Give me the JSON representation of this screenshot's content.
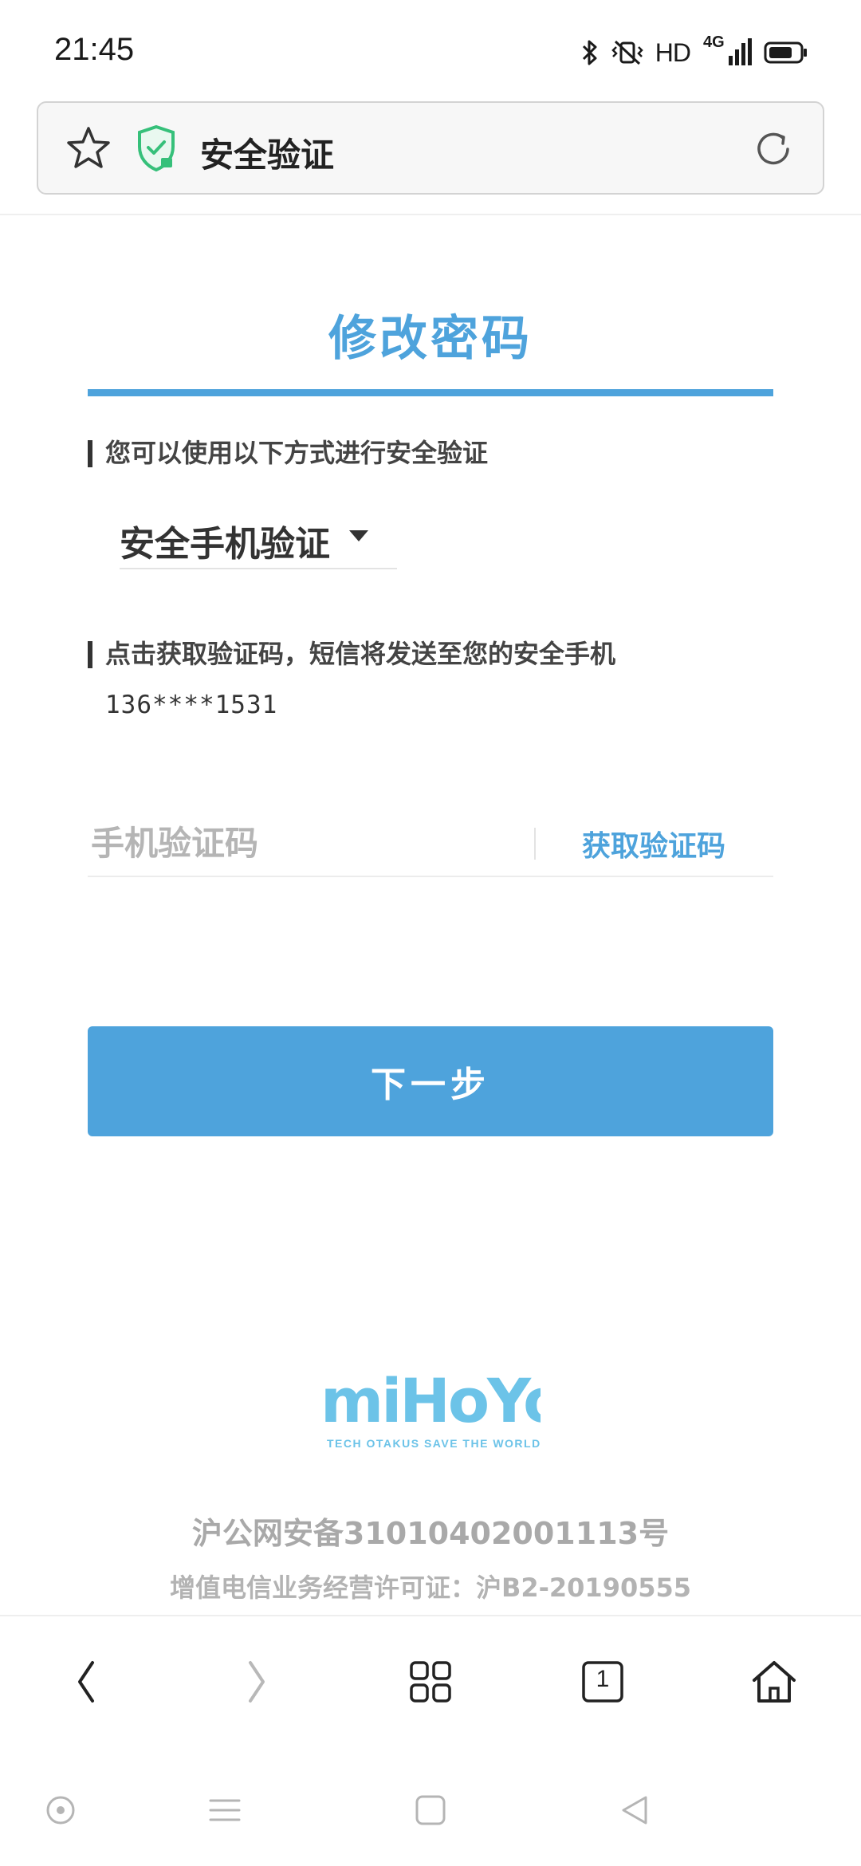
{
  "status_bar": {
    "time": "21:45",
    "hd": "HD",
    "network": "4G",
    "icons": [
      "bluetooth-icon",
      "vibrate-icon",
      "signal-icon",
      "battery-icon"
    ]
  },
  "address_bar": {
    "title": "安全验证",
    "icons": [
      "star-icon",
      "shield-icon",
      "reload-icon"
    ]
  },
  "page": {
    "title": "修改密码",
    "method_label": "您可以使用以下方式进行安全验证",
    "method_selected": "安全手机验证",
    "sms_label": "点击获取验证码，短信将发送至您的安全手机",
    "phone": "136****1531",
    "code_placeholder": "手机验证码",
    "get_code_label": "获取验证码",
    "next_label": "下一步"
  },
  "footer": {
    "logo_text": "miHoYo",
    "logo_tagline": "TECH OTAKUS SAVE THE WORLD",
    "icp_1": "沪公网安备31010402001113号",
    "icp_2": "增值电信业务经营许可证：沪B2-20190555"
  },
  "browser_bar": {
    "tab_count": "1",
    "items": [
      "back-icon",
      "forward-icon",
      "menu-grid-icon",
      "tabs-icon",
      "home-icon"
    ]
  },
  "system_nav": {
    "items": [
      "assistant-icon",
      "menu-icon",
      "home-icon",
      "back-icon"
    ]
  },
  "colors": {
    "accent": "#4ea3dc",
    "text": "#333333",
    "muted": "#b5b5b5"
  }
}
